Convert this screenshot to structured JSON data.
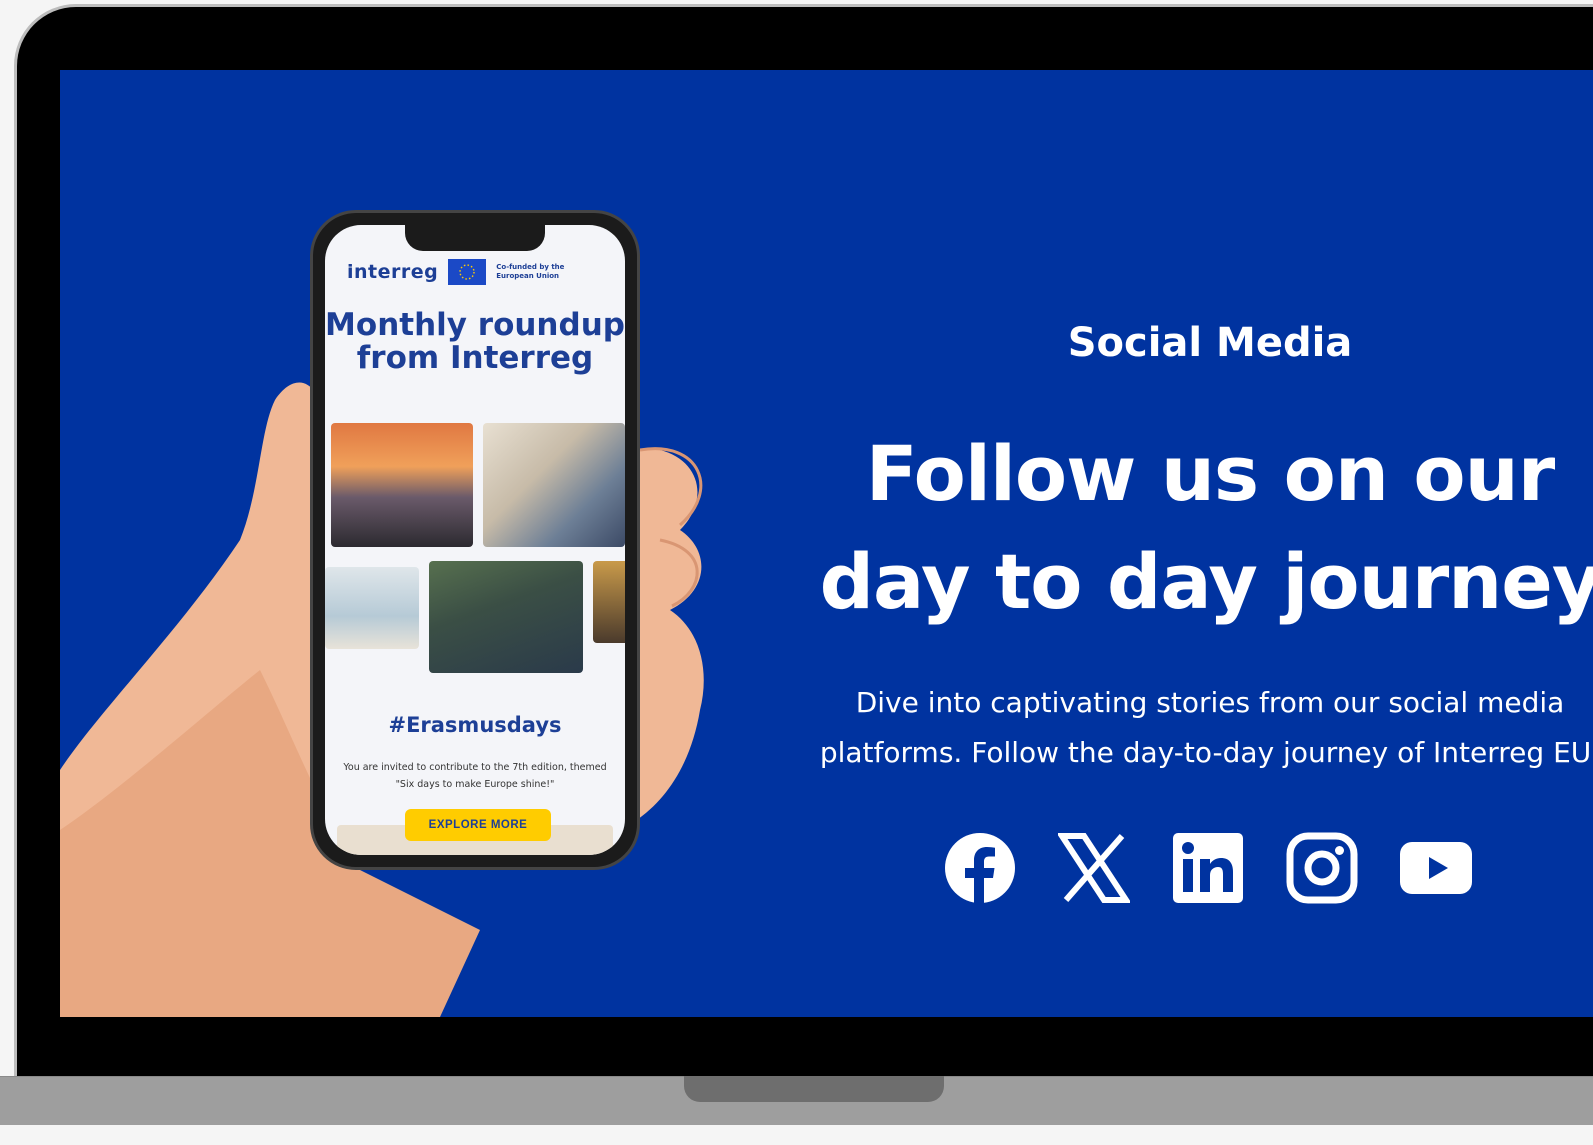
{
  "colors": {
    "screen_bg": "#0033a0",
    "brand_blue": "#1d3f96",
    "button_yellow": "#ffcc00",
    "text_white": "#ffffff"
  },
  "phone": {
    "logo_text": "interreg",
    "eu_badge_text": "Co-funded by the European Union",
    "title": "Monthly roundup from Interreg",
    "hashtag": "#Erasmusdays",
    "invite_text": "You are invited to contribute to the 7th edition, themed \"Six days to make Europe shine!\"",
    "button_label": "EXPLORE MORE"
  },
  "section": {
    "eyebrow": "Social Media",
    "headline_line1": "Follow us on our",
    "headline_line2": "day to day journey",
    "description_line1": "Dive into captivating stories from our social media",
    "description_line2": "platforms. Follow the day-to-day journey of Interreg EU."
  },
  "social_links": [
    {
      "icon": "facebook-icon"
    },
    {
      "icon": "x-icon"
    },
    {
      "icon": "linkedin-icon"
    },
    {
      "icon": "instagram-icon"
    },
    {
      "icon": "youtube-icon"
    }
  ]
}
